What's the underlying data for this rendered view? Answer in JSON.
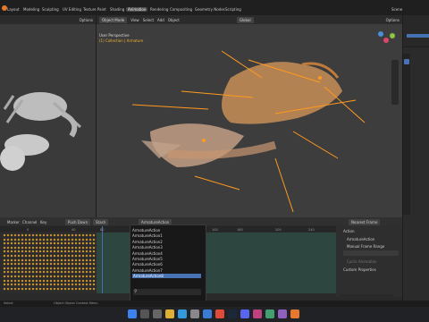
{
  "menu": {
    "items": [
      "Layout",
      "Modeling",
      "Sculpting",
      "UV Editing",
      "Texture Paint",
      "Shading",
      "Animation",
      "Rendering",
      "Compositing",
      "Geometry Nodes",
      "Scripting"
    ],
    "active_index": 6,
    "scene_label": "Scene"
  },
  "viewport": {
    "mode": "Object Mode",
    "menus": [
      "View",
      "Select",
      "Add",
      "Object"
    ],
    "orientation": "Global",
    "perspective": "User Perspective",
    "collection": "(1) Collection | Armature",
    "options": "Options"
  },
  "left_viewport": {
    "options": "Options"
  },
  "timeline": {
    "menus": [
      "Marker",
      "Channel",
      "Key"
    ],
    "push_down": "Push Down",
    "stash": "Stash",
    "action_name": "ArmatureAction",
    "interpolation": "Nearest Frame",
    "ruler": [
      "0",
      "40",
      "80",
      "100",
      "160",
      "200",
      "240"
    ]
  },
  "dropdown": {
    "items": [
      "ArmatureAction",
      "ArmatureAction1",
      "ArmatureAction2",
      "ArmatureAction3",
      "ArmatureAction4",
      "ArmatureAction5",
      "ArmatureAction6",
      "ArmatureAction7",
      "ArmatureAction8"
    ],
    "selected_index": 8,
    "search_placeholder": ""
  },
  "action_panel": {
    "title": "Action",
    "action": "ArmatureAction",
    "manual_frame_range": "Manual Frame Range",
    "cyclic_animation": "Cyclic Animation",
    "custom_properties": "Custom Properties"
  },
  "status": {
    "left": "Select",
    "middle": "Object Object Context Menu"
  },
  "colors": {
    "selected": "#4772b3",
    "bone": "#ff9a1f",
    "key": "#e8a630"
  }
}
